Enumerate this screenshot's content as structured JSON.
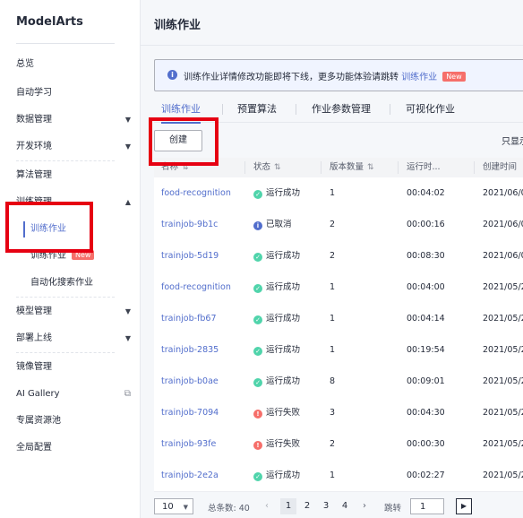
{
  "sidebar": {
    "brand": "ModelArts",
    "items": [
      {
        "label": "总览"
      },
      {
        "label": "自动学习"
      },
      {
        "label": "数据管理"
      },
      {
        "label": "开发环境"
      },
      {
        "label": "算法管理"
      },
      {
        "label": "训练管理"
      },
      {
        "label": "模型管理"
      },
      {
        "label": "部署上线"
      },
      {
        "label": "镜像管理"
      },
      {
        "label": "AI Gallery"
      },
      {
        "label": "专属资源池"
      },
      {
        "label": "全局配置"
      }
    ],
    "sub_items": [
      {
        "label": "训练作业"
      },
      {
        "label": "训练作业",
        "badge": "New"
      },
      {
        "label": "自动化搜索作业"
      }
    ]
  },
  "page": {
    "title": "训练作业"
  },
  "notice": {
    "text": "训练作业详情修改功能即将下线，更多功能体验请跳转",
    "link": "训练作业",
    "badge": "New"
  },
  "tabs": [
    "训练作业",
    "预置算法",
    "作业参数管理",
    "可视化作业"
  ],
  "toolbar": {
    "create_label": "创建",
    "only_show": "只显示"
  },
  "table": {
    "columns": [
      "名称",
      "状态",
      "版本数量",
      "运行时...",
      "创建时间"
    ],
    "rows": [
      {
        "name": "food-recognition",
        "status": "运行成功",
        "status_type": "ok",
        "versions": "1",
        "runtime": "00:04:02",
        "created": "2021/06/0"
      },
      {
        "name": "trainjob-9b1c",
        "status": "已取消",
        "status_type": "info",
        "versions": "2",
        "runtime": "00:00:16",
        "created": "2021/06/0"
      },
      {
        "name": "trainjob-5d19",
        "status": "运行成功",
        "status_type": "ok",
        "versions": "2",
        "runtime": "00:08:30",
        "created": "2021/06/0"
      },
      {
        "name": "food-recognition",
        "status": "运行成功",
        "status_type": "ok",
        "versions": "1",
        "runtime": "00:04:00",
        "created": "2021/05/2"
      },
      {
        "name": "trainjob-fb67",
        "status": "运行成功",
        "status_type": "ok",
        "versions": "1",
        "runtime": "00:04:14",
        "created": "2021/05/2"
      },
      {
        "name": "trainjob-2835",
        "status": "运行成功",
        "status_type": "ok",
        "versions": "1",
        "runtime": "00:19:54",
        "created": "2021/05/2"
      },
      {
        "name": "trainjob-b0ae",
        "status": "运行成功",
        "status_type": "ok",
        "versions": "8",
        "runtime": "00:09:01",
        "created": "2021/05/2"
      },
      {
        "name": "trainjob-7094",
        "status": "运行失败",
        "status_type": "fail",
        "versions": "3",
        "runtime": "00:04:30",
        "created": "2021/05/2"
      },
      {
        "name": "trainjob-93fe",
        "status": "运行失败",
        "status_type": "fail",
        "versions": "2",
        "runtime": "00:00:30",
        "created": "2021/05/2"
      },
      {
        "name": "trainjob-2e2a",
        "status": "运行成功",
        "status_type": "ok",
        "versions": "1",
        "runtime": "00:02:27",
        "created": "2021/05/2"
      }
    ]
  },
  "pagination": {
    "page_size": "10",
    "total_label": "总条数: 40",
    "pages": [
      "1",
      "2",
      "3",
      "4"
    ],
    "current": "1",
    "jump_label": "跳转",
    "jump_value": "1"
  },
  "colors": {
    "accent": "#526ecc",
    "success": "#50d4ab",
    "fail": "#f66f6a",
    "annotation": "#e60012"
  }
}
